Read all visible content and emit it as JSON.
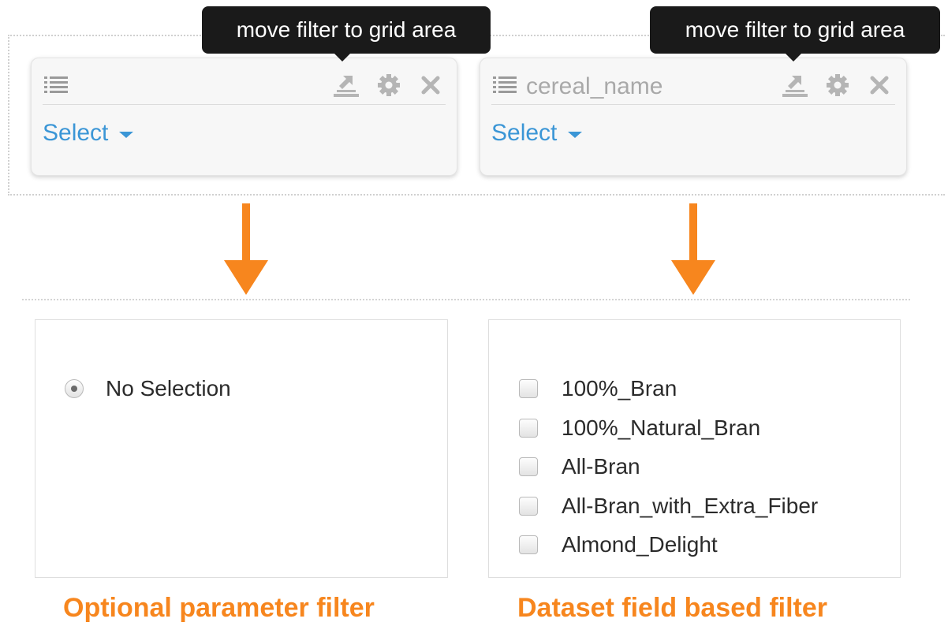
{
  "filters": [
    {
      "field_name": "",
      "select_label": "Select",
      "tooltip": "move filter to grid area",
      "icons": {
        "list": "list-icon",
        "move": "move-to-grid-icon",
        "settings": "gear-icon",
        "close": "close-icon"
      }
    },
    {
      "field_name": "cereal_name",
      "select_label": "Select",
      "tooltip": "move filter to grid area",
      "icons": {
        "list": "list-icon",
        "move": "move-to-grid-icon",
        "settings": "gear-icon",
        "close": "close-icon"
      }
    }
  ],
  "optional_filter": {
    "radio_label": "No Selection",
    "selected": true,
    "caption": "Optional parameter filter"
  },
  "dataset_filter": {
    "options": [
      "100%_Bran",
      "100%_Natural_Bran",
      "All-Bran",
      "All-Bran_with_Extra_Fiber",
      "Almond_Delight"
    ],
    "caption": "Dataset field based filter"
  },
  "colors": {
    "accent_blue": "#3b96d6",
    "caption_orange": "#f7861e",
    "arrow_orange": "#f7861e",
    "tooltip_bg": "#1a1a1a"
  }
}
